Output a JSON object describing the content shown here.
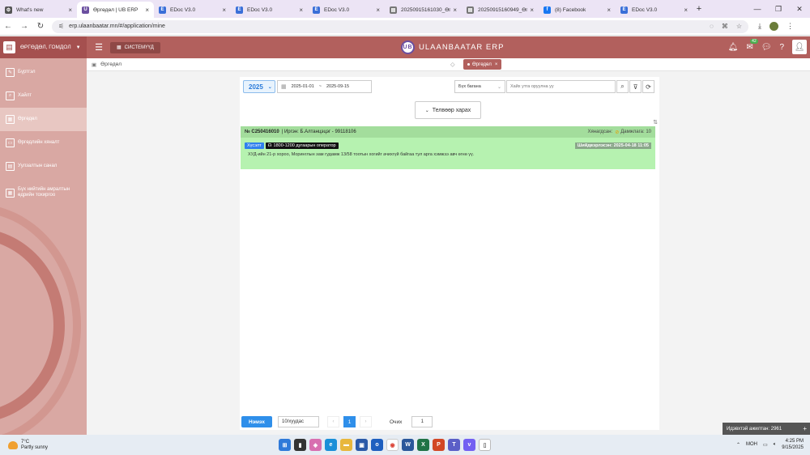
{
  "browser": {
    "tabs": [
      {
        "label": "What's new",
        "icon": "gear-icon",
        "color": "#555555",
        "glyph": "⚙"
      },
      {
        "label": "Өргөдөл | UB ERP",
        "icon": "ub-logo-icon",
        "color": "#6b4fa0",
        "glyph": "U"
      },
      {
        "label": "EDoc V3.0",
        "icon": "edoc-icon",
        "color": "#3a6fd8",
        "glyph": "E"
      },
      {
        "label": "EDoc V3.0",
        "icon": "edoc-icon",
        "color": "#3a6fd8",
        "glyph": "E"
      },
      {
        "label": "EDoc V3.0",
        "icon": "edoc-icon",
        "color": "#3a6fd8",
        "glyph": "E"
      },
      {
        "label": "20250915161030_Өг",
        "icon": "document-icon",
        "color": "#777777",
        "glyph": "▤"
      },
      {
        "label": "20250915160949_Өг",
        "icon": "document-icon",
        "color": "#777777",
        "glyph": "▤"
      },
      {
        "label": "(8) Facebook",
        "icon": "facebook-icon",
        "color": "#1877f2",
        "glyph": "f"
      },
      {
        "label": "EDoc V3.0",
        "icon": "edoc-icon",
        "color": "#3a6fd8",
        "glyph": "E"
      }
    ],
    "url": "erp.ulaanbaatar.mn/#/application/mine"
  },
  "app": {
    "org_name": "ӨРГӨДӨЛ, ГОМДОЛ",
    "system_button": "СИСТЕМҮҮД",
    "brand": "ULAANBAATAR ERP",
    "brand_logo": "UB",
    "mail_badge": "42"
  },
  "breadcrumb": {
    "page": "Өргөдөл",
    "tag": "Өргөдөл"
  },
  "sidebar": {
    "items": [
      {
        "label": "Бүртгэл",
        "icon": "edit-icon"
      },
      {
        "label": "Хайлт",
        "icon": "search-icon"
      },
      {
        "label": "Өргөдөл",
        "icon": "calendar-icon"
      },
      {
        "label": "Өргөдлийн хяналт",
        "icon": "monitor-icon"
      },
      {
        "label": "Уулзалтын санал",
        "icon": "note-icon"
      },
      {
        "label": "Бүх нийтийн амралтын өдрийн тохиргоо",
        "icon": "calendar-settings-icon"
      }
    ]
  },
  "filters": {
    "year": "2025",
    "date_from": "2025-01-01",
    "date_sep": "~",
    "date_to": "2025-09-15",
    "column_select": "Бүх багана",
    "search_placeholder": "Хайх утга оруулна уу",
    "detail_button": "Телвөөр харах"
  },
  "record": {
    "number": "№ C250416010",
    "applicant": "| Иргэн: Б.Алтанцэцэг - 99118106",
    "status_label": "Хянагдсан:",
    "status_value": "Дамжлага: 10",
    "type_badge": "Хүсэлт",
    "source_badge": "1800-1200 дугаарын оператор",
    "date_badge": "Шийдвэрлэсэн: 2025-04-18 11:05",
    "text": "ХУД-ийн 21-р хороо, Моринглын зам гудамж 13/58 тоотын хогийг ачихгүй байгаа тул арга хэмжээ авч өгнө үү."
  },
  "pager": {
    "add_button": "Нэмэх",
    "per_page": "10/хуудас",
    "current_page": "1",
    "go_label": "Очих",
    "go_value": "1"
  },
  "pending": {
    "label": "Идэвхтэй ажилтан: 2961",
    "plus": "+"
  },
  "taskbar": {
    "temp": "7°C",
    "weather": "Partly sunny",
    "lang": "МОН",
    "time": "4:25 PM",
    "date": "9/15/2025"
  }
}
